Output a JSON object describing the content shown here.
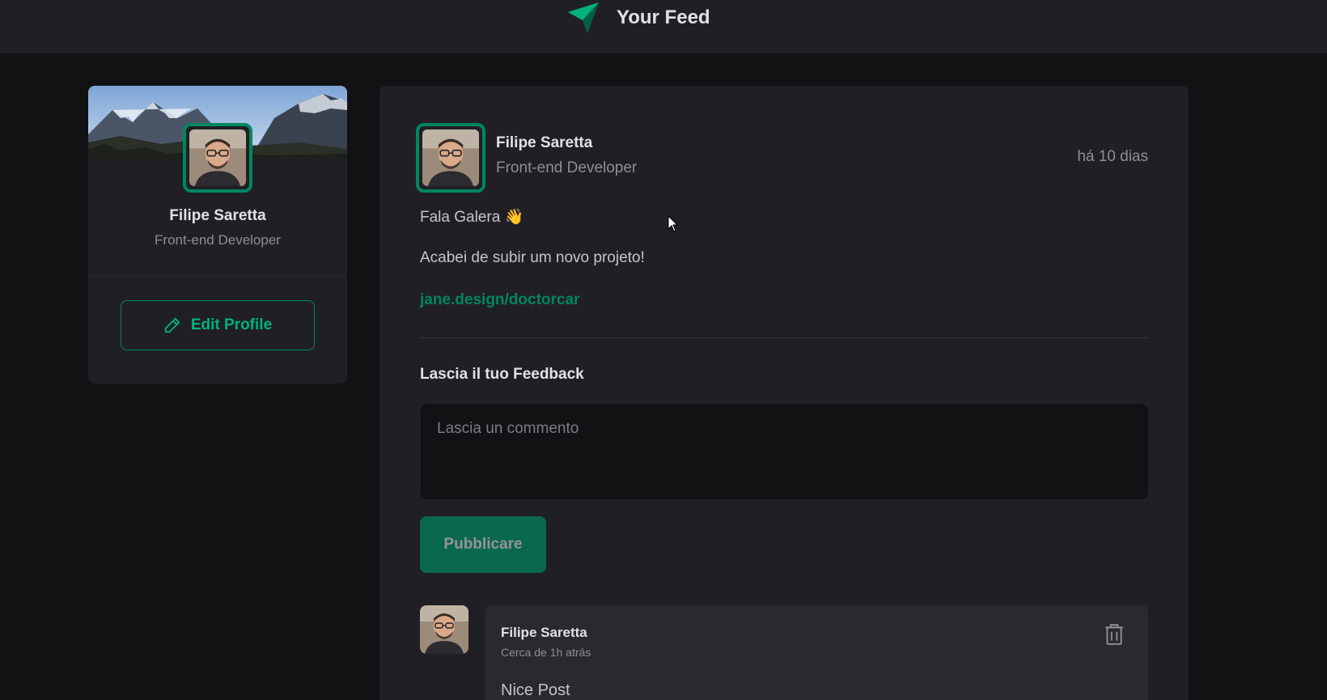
{
  "header": {
    "title": "Your Feed",
    "logo_icon": "paper-plane-icon"
  },
  "sidebar": {
    "name": "Filipe Saretta",
    "role": "Front-end Developer",
    "edit_label": "Edit Profile"
  },
  "post": {
    "author": {
      "name": "Filipe Saretta",
      "role": "Front-end Developer"
    },
    "time": "há 10 dias",
    "content": [
      "Fala Galera 👋",
      "Acabei de subir um novo projeto!"
    ],
    "link": "jane.design/doctorcar"
  },
  "feedback": {
    "title": "Lascia il tuo Feedback",
    "placeholder": "Lascia un commento",
    "publish_label": "Pubblicare"
  },
  "comments": [
    {
      "author": "Filipe Saretta",
      "time": "Cerca de 1h atrás",
      "text": "Nice Post"
    }
  ],
  "colors": {
    "accent": "#00875f",
    "accent_light": "#00b37e",
    "bg": "#121214",
    "card": "#202024"
  }
}
